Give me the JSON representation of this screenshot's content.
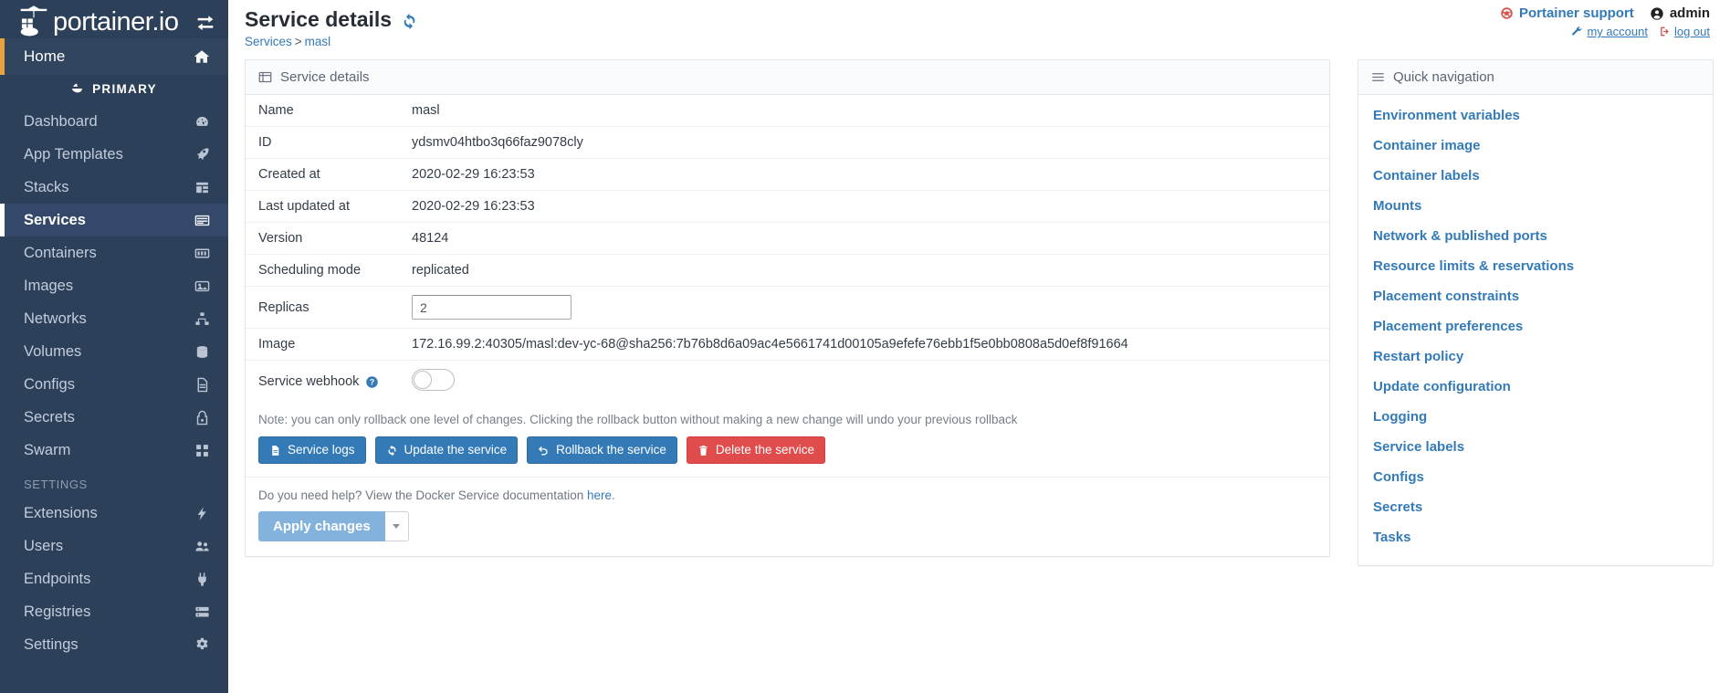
{
  "sidebar": {
    "brand": "portainer.io",
    "toggle_icon": "sidebar-toggle-icon",
    "home": {
      "label": "Home",
      "icon": "home-icon"
    },
    "endpoint": {
      "label": "PRIMARY",
      "icon": "whale-icon"
    },
    "items": [
      {
        "label": "Dashboard",
        "icon": "dashboard-icon",
        "active": false
      },
      {
        "label": "App Templates",
        "icon": "rocket-icon",
        "active": false
      },
      {
        "label": "Stacks",
        "icon": "stacks-icon",
        "active": false
      },
      {
        "label": "Services",
        "icon": "services-icon",
        "active": true
      },
      {
        "label": "Containers",
        "icon": "containers-icon",
        "active": false
      },
      {
        "label": "Images",
        "icon": "images-icon",
        "active": false
      },
      {
        "label": "Networks",
        "icon": "networks-icon",
        "active": false
      },
      {
        "label": "Volumes",
        "icon": "volumes-icon",
        "active": false
      },
      {
        "label": "Configs",
        "icon": "configs-icon",
        "active": false
      },
      {
        "label": "Secrets",
        "icon": "secrets-icon",
        "active": false
      },
      {
        "label": "Swarm",
        "icon": "swarm-icon",
        "active": false
      }
    ],
    "settings_section": "SETTINGS",
    "settings_items": [
      {
        "label": "Extensions",
        "icon": "bolt-icon"
      },
      {
        "label": "Users",
        "icon": "users-icon"
      },
      {
        "label": "Endpoints",
        "icon": "plug-icon"
      },
      {
        "label": "Registries",
        "icon": "registries-icon"
      },
      {
        "label": "Settings",
        "icon": "cogs-icon"
      }
    ]
  },
  "header": {
    "title": "Service details",
    "refresh_icon": "refresh-icon",
    "breadcrumb": {
      "root": "Services",
      "separator": ">",
      "current": "masl"
    },
    "support_label": "Portainer support",
    "support_icon": "life-ring-icon",
    "user_label": "admin",
    "user_icon": "user-circle-icon",
    "my_account_label": "my account",
    "my_account_icon": "wrench-icon",
    "logout_label": "log out",
    "logout_icon": "sign-out-icon"
  },
  "details_panel": {
    "heading": "Service details",
    "heading_icon": "list-alt-icon",
    "rows": [
      {
        "key": "Name",
        "value": "masl"
      },
      {
        "key": "ID",
        "value": "ydsmv04htbo3q66faz9078cly"
      },
      {
        "key": "Created at",
        "value": "2020-02-29 16:23:53"
      },
      {
        "key": "Last updated at",
        "value": "2020-02-29 16:23:53"
      },
      {
        "key": "Version",
        "value": "48124"
      },
      {
        "key": "Scheduling mode",
        "value": "replicated"
      }
    ],
    "replicas": {
      "key": "Replicas",
      "value": "2"
    },
    "image": {
      "key": "Image",
      "value": "172.16.99.2:40305/masl:dev-yc-68@sha256:7b76b8d6a09ac4e5661741d00105a9efefe76ebb1f5e0bb0808a5d0ef8f91664"
    },
    "webhook": {
      "key": "Service webhook",
      "help_icon": "question-circle-icon",
      "toggle_state": "off"
    },
    "note": "Note: you can only rollback one level of changes. Clicking the rollback button without making a new change will undo your previous rollback",
    "buttons": [
      {
        "label": "Service logs",
        "icon": "file-text-icon",
        "style": "primary"
      },
      {
        "label": "Update the service",
        "icon": "sync-icon",
        "style": "primary"
      },
      {
        "label": "Rollback the service",
        "icon": "undo-icon",
        "style": "primary"
      },
      {
        "label": "Delete the service",
        "icon": "trash-icon",
        "style": "danger"
      }
    ],
    "footer": {
      "help_prefix": "Do you need help? View the Docker Service documentation ",
      "help_link": "here",
      "help_suffix": ".",
      "apply_label": "Apply changes",
      "caret_icon": "caret-down-icon"
    }
  },
  "quick_nav": {
    "heading": "Quick navigation",
    "heading_icon": "bars-icon",
    "links": [
      "Environment variables",
      "Container image",
      "Container labels",
      "Mounts",
      "Network & published ports",
      "Resource limits & reservations",
      "Placement constraints",
      "Placement preferences",
      "Restart policy",
      "Update configuration",
      "Logging",
      "Service labels",
      "Configs",
      "Secrets",
      "Tasks"
    ]
  },
  "colors": {
    "sidebar_bg": "#2c405a",
    "accent_blue": "#337ab7",
    "danger_red": "#e04b4b",
    "home_marker": "#e8a33d"
  }
}
